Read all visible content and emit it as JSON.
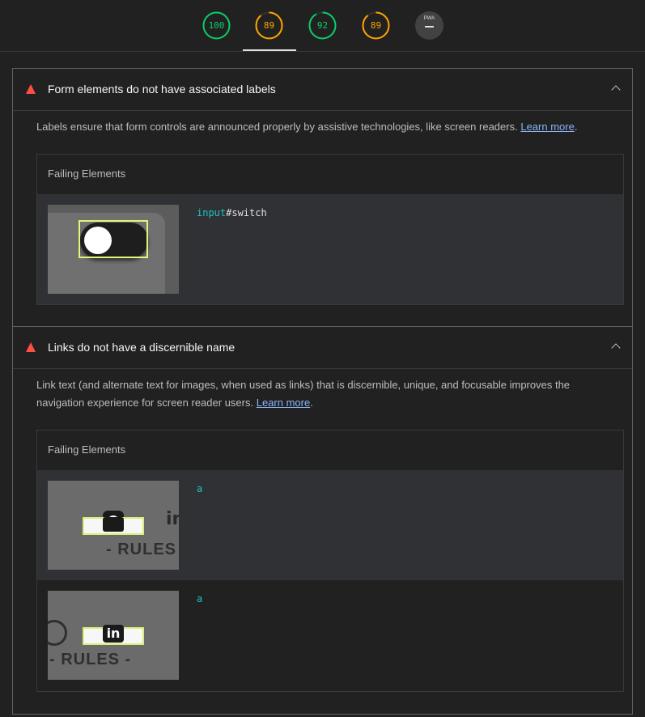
{
  "scores": [
    {
      "label": "100",
      "value": 100,
      "status": "good",
      "color": "#0cce6b"
    },
    {
      "label": "89",
      "value": 89,
      "status": "average",
      "color": "#ffa400"
    },
    {
      "label": "92",
      "value": 92,
      "status": "good",
      "color": "#0cce6b"
    },
    {
      "label": "89",
      "value": 89,
      "status": "average",
      "color": "#ffa400"
    },
    {
      "label": "PWA",
      "icon": "pwa-badge-icon"
    }
  ],
  "audits": [
    {
      "title": "Form elements do not have associated labels",
      "description": "Labels ensure that form controls are announced properly by assistive technologies, like screen readers.",
      "learn_more": "Learn more",
      "failing_label": "Failing Elements",
      "items": [
        {
          "tag": "input",
          "selector": "#switch"
        }
      ]
    },
    {
      "title": "Links do not have a discernible name",
      "description_line1": "Link text (and alternate text for images, when used as links) that is discernible, unique, and focusable improves the",
      "description_line2": "navigation experience for screen reader users.",
      "learn_more": "Learn more",
      "failing_label": "Failing Elements",
      "items": [
        {
          "tag": "a",
          "thumb_text": "- RULES",
          "icon": "github-icon"
        },
        {
          "tag": "a",
          "thumb_text": "- RULES -",
          "icon": "linkedin-icon"
        }
      ]
    }
  ]
}
